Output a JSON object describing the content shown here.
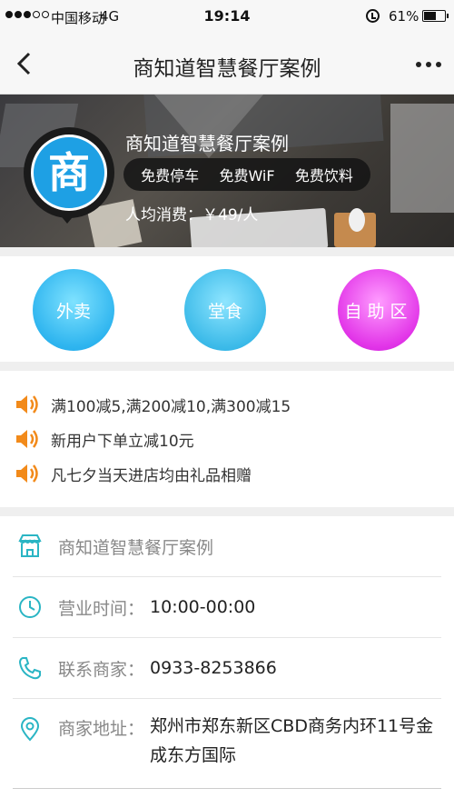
{
  "status_bar": {
    "carrier": "中国移动",
    "network": "4G",
    "time": "19:14",
    "battery": "61%",
    "battery_level": 0.61
  },
  "nav": {
    "title": "商知道智慧餐厅案例",
    "back_icon": "chevron-left-icon",
    "more_icon": "more-dots-icon"
  },
  "banner": {
    "logo_char": "商",
    "shop_name": "商知道智慧餐厅案例",
    "tags": [
      "免费停车",
      "免费WiF",
      "免费饮料"
    ],
    "avg_spend": "人均消费：￥49/人"
  },
  "quick_entries": [
    {
      "label": "外卖",
      "color": "#2fb5ef"
    },
    {
      "label": "堂食",
      "color": "#3dbbe9"
    },
    {
      "label": "自助区",
      "color": "#e235e8"
    }
  ],
  "promotions": [
    {
      "icon": "speaker-icon",
      "text": "满100减5,满200减10,满300减15"
    },
    {
      "icon": "speaker-icon",
      "text": "新用户下单立减10元"
    },
    {
      "icon": "speaker-icon",
      "text": "凡七夕当天进店均由礼品相赠"
    }
  ],
  "info": {
    "name": {
      "icon": "store-icon",
      "label": "商知道智慧餐厅案例"
    },
    "hours": {
      "icon": "clock-icon",
      "label": "营业时间：",
      "value": "10:00-00:00"
    },
    "phone": {
      "icon": "phone-icon",
      "label": "联系商家：",
      "value": "0933-8253866"
    },
    "address": {
      "icon": "location-pin-icon",
      "label": "商家地址：",
      "value": "郑州市郑东新区CBD商务内环11号金成东方国际"
    }
  },
  "colors": {
    "accent": "#2ab5c4",
    "speaker": "#f28a1a",
    "logo": "#1ea0e4"
  }
}
